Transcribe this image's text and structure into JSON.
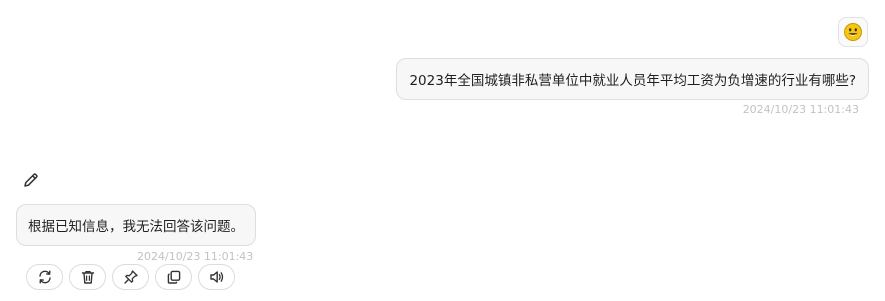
{
  "user_message": {
    "avatar_icon": "smiley-face-icon",
    "text": "2023年全国城镇非私营单位中就业人员年平均工资为负增速的行业有哪些?",
    "timestamp": "2024/10/23 11:01:43"
  },
  "bot_message": {
    "avatar_icon": "pencil-icon",
    "text": "根据已知信息，我无法回答该问题。",
    "timestamp": "2024/10/23 11:01:43"
  },
  "actions": [
    {
      "name": "regenerate",
      "icon": "refresh-icon"
    },
    {
      "name": "delete",
      "icon": "trash-icon"
    },
    {
      "name": "pin",
      "icon": "pin-icon"
    },
    {
      "name": "copy",
      "icon": "copy-icon"
    },
    {
      "name": "read-aloud",
      "icon": "speaker-icon"
    }
  ],
  "colors": {
    "bubble_bg": "#f7f7f7",
    "bubble_border": "#dedede",
    "timestamp": "#c2c2c2",
    "emoji": "#f5c518"
  }
}
